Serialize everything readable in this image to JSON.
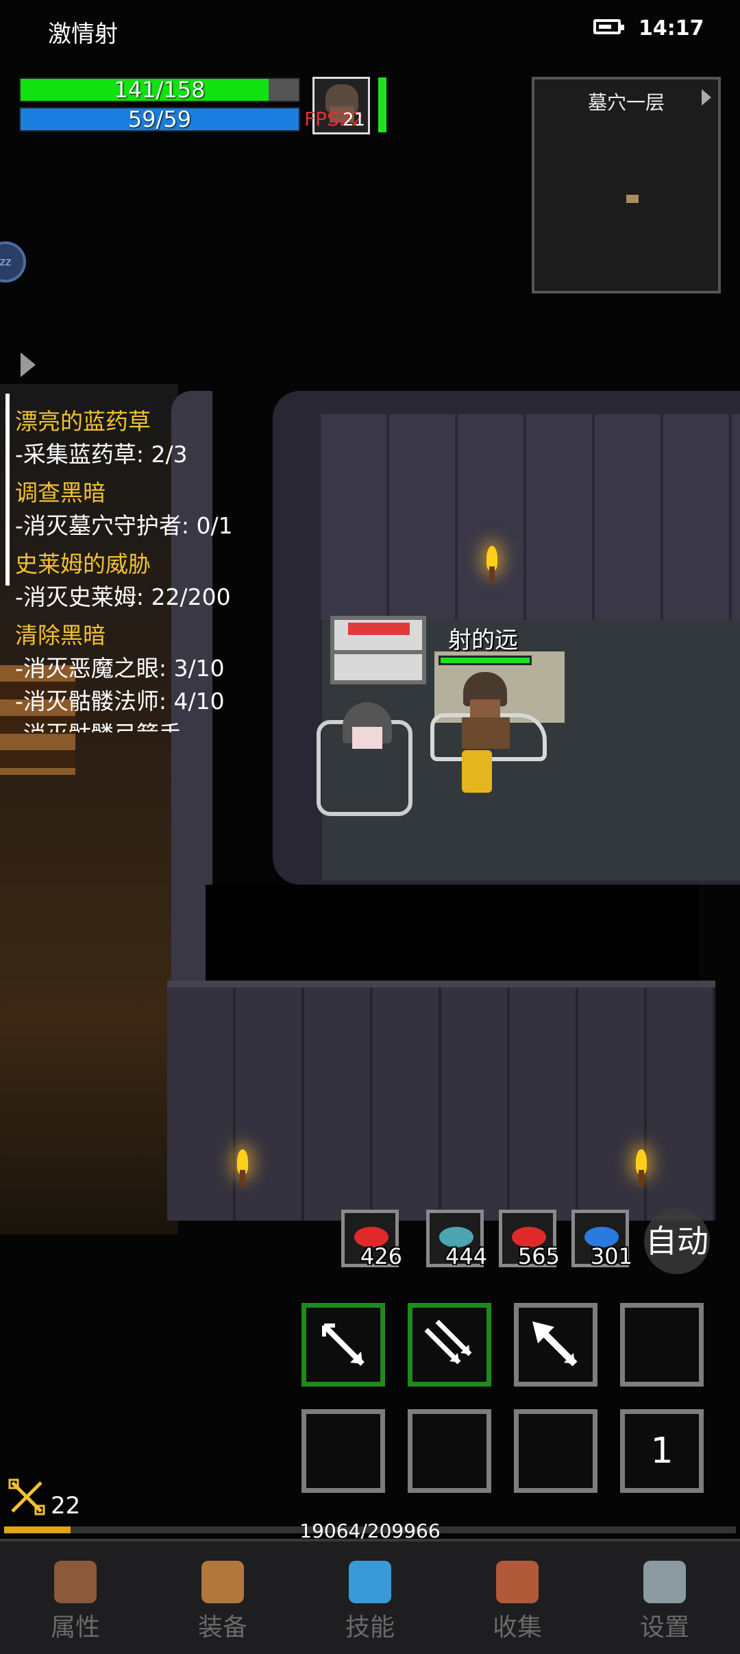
{
  "status_bar": {
    "app_title": "激情射",
    "time": "14:17",
    "battery_icon": "battery-icon"
  },
  "player_stats": {
    "hp_text": "141/158",
    "hp_fraction": 0.892,
    "mp_text": "59/59",
    "mp_fraction": 1.0,
    "fps_text": "FPS22",
    "portrait_level": "21"
  },
  "minimap": {
    "title": "墓穴一层"
  },
  "quests": [
    {
      "title": "漂亮的蓝药草",
      "subs": [
        "-采集蓝药草: 2/3"
      ]
    },
    {
      "title": "调查黑暗",
      "subs": [
        "-消灭墓穴守护者: 0/1"
      ]
    },
    {
      "title": "史莱姆的威胁",
      "subs": [
        "-消灭史莱姆: 22/200"
      ]
    },
    {
      "title": "清除黑暗",
      "subs": [
        "-消灭恶魔之眼: 3/10",
        "-消灭骷髅法师: 4/10",
        "-消灭骷髅弓箭手"
      ]
    }
  ],
  "scene": {
    "player_name": "射的远"
  },
  "consumables": [
    {
      "icon": "red-meat-icon",
      "count": "426",
      "color": "#e02a2a"
    },
    {
      "icon": "fish-icon",
      "count": "444",
      "color": "#4aa6b0"
    },
    {
      "icon": "red-meat-icon",
      "count": "565",
      "color": "#e02a2a"
    },
    {
      "icon": "blue-meat-icon",
      "count": "301",
      "color": "#2a7ae0"
    }
  ],
  "auto_label": "自动",
  "skill_slots": {
    "row1": [
      {
        "icon": "arrow-skill-icon",
        "active": true
      },
      {
        "icon": "double-arrow-skill-icon",
        "active": true
      },
      {
        "icon": "piercing-arrow-skill-icon",
        "active": false
      },
      {
        "icon": "empty-slot",
        "active": false
      }
    ],
    "row2_last_number": "1"
  },
  "level": {
    "value": "22",
    "xp_text": "19064/209966",
    "xp_fraction": 0.091
  },
  "nav": [
    {
      "label": "属性",
      "icon": "helmet-icon",
      "color": "#8a5a3a"
    },
    {
      "label": "装备",
      "icon": "bag-icon",
      "color": "#b0783a"
    },
    {
      "label": "技能",
      "icon": "crystal-icon",
      "color": "#3a9ad8"
    },
    {
      "label": "收集",
      "icon": "book-icon",
      "color": "#b05a3a"
    },
    {
      "label": "设置",
      "icon": "gear-icon",
      "color": "#8a9aa0"
    }
  ]
}
